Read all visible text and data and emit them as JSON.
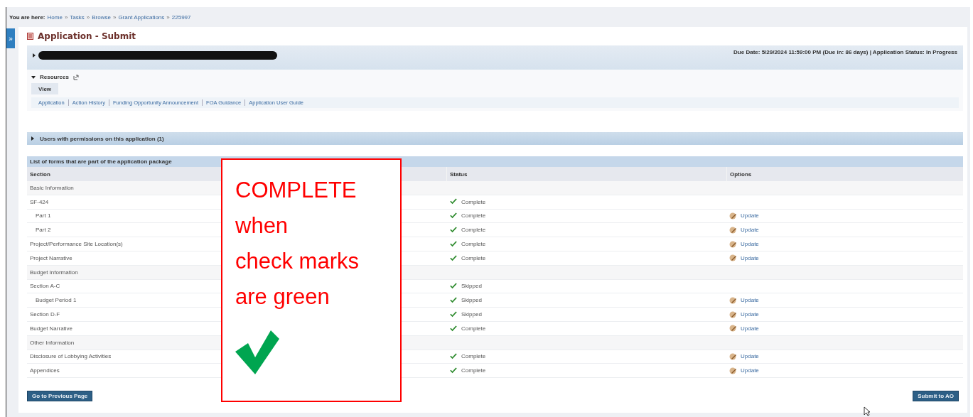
{
  "breadcrumb": {
    "label": "You are here:",
    "items": [
      "Home",
      "Tasks",
      "Browse",
      "Grant Applications",
      "225997"
    ],
    "separator": "»"
  },
  "sidebar_toggle": {
    "label": "»"
  },
  "page_title": "Application - Submit",
  "header": {
    "redacted": true,
    "due": "Due Date: 5/29/2024 11:59:00 PM (Due in: 86 days) | Application Status: In Progress"
  },
  "resources": {
    "title": "Resources",
    "expanded": true,
    "tabs": [
      {
        "label": "View",
        "selected": true
      }
    ],
    "links": [
      "Application",
      "Action History",
      "Funding Opportunity Announcement",
      "FOA Guidance",
      "Application User Guide"
    ]
  },
  "users_panel": {
    "title": "Users with permissions on this application (1)",
    "expanded": false
  },
  "table": {
    "title": "List of forms that are part of the application package",
    "columns": [
      "Section",
      "Status",
      "Options"
    ],
    "rows": [
      {
        "kind": "group",
        "section": "Basic Information"
      },
      {
        "kind": "form",
        "section": "SF-424",
        "status": "Complete",
        "children": [
          {
            "kind": "form",
            "section": "Part 1",
            "status": "Complete",
            "option": "Update"
          },
          {
            "kind": "form",
            "section": "Part 2",
            "status": "Complete",
            "option": "Update"
          }
        ]
      },
      {
        "kind": "form",
        "section": "Project/Performance Site Location(s)",
        "status": "Complete",
        "option": "Update"
      },
      {
        "kind": "form",
        "section": "Project Narrative",
        "status": "Complete",
        "option": "Update"
      },
      {
        "kind": "group",
        "section": "Budget Information"
      },
      {
        "kind": "form",
        "section": "Section A-C",
        "status": "Skipped",
        "children": [
          {
            "kind": "form",
            "section": "Budget Period 1",
            "status": "Skipped",
            "option": "Update"
          }
        ]
      },
      {
        "kind": "form",
        "section": "Section D-F",
        "status": "Skipped",
        "option": "Update"
      },
      {
        "kind": "form",
        "section": "Budget Narrative",
        "status": "Complete",
        "option": "Update"
      },
      {
        "kind": "group",
        "section": "Other Information"
      },
      {
        "kind": "form",
        "section": "Disclosure of Lobbying Activities",
        "status": "Complete",
        "option": "Update"
      },
      {
        "kind": "form",
        "section": "Appendices",
        "status": "Complete",
        "option": "Update"
      }
    ]
  },
  "buttons": {
    "previous": "Go to Previous Page",
    "submit": "Submit to AO"
  },
  "annotation": {
    "lines": [
      "COMPLETE",
      "when",
      "check marks",
      "are green"
    ]
  }
}
